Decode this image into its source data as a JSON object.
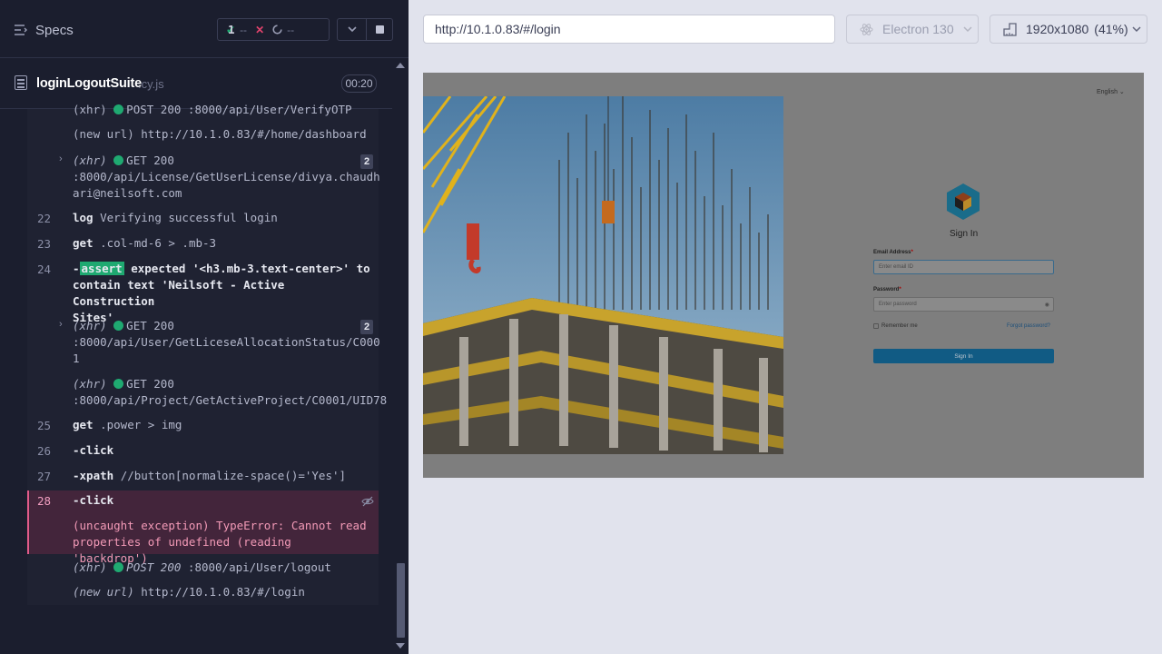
{
  "reporter": {
    "specs_label": "Specs",
    "stats": {
      "passed": "--",
      "failed": "1",
      "pending": "--"
    },
    "file": {
      "name": "loginLogoutSuite",
      "ext": ".cy.js",
      "duration": "00:20"
    }
  },
  "log": {
    "r0": {
      "kind": "(xhr)",
      "method": "POST 200",
      "url": ":8000/api/User/VerifyOTP"
    },
    "r1": {
      "kind": "(new url)",
      "url": "http://10.1.0.83/#/home/dashboard"
    },
    "r2": {
      "kind": "(xhr)",
      "method": "GET 200",
      "url1": ":8000/api/License/GetUserLicense/divya.chaudh",
      "url2": "ari@neilsoft.com",
      "count": "2"
    },
    "r3": {
      "num": "22",
      "name": "log",
      "msg": "Verifying successful login"
    },
    "r4": {
      "num": "23",
      "name": "get",
      "msg": ".col-md-6 > .mb-3"
    },
    "r5": {
      "num": "24",
      "prefix": "-",
      "name": "assert",
      "t1": "expected",
      "v1": "'<h3.mb-3.text-center>'",
      "t2": "to",
      "t3": "contain text",
      "v2a": "'Neilsoft - Active Construction",
      "v2b": "Sites'"
    },
    "r6": {
      "kind": "(xhr)",
      "method": "GET 200",
      "url1": ":8000/api/User/GetLiceseAllocationStatus/C000",
      "url2": "1",
      "count": "2"
    },
    "r7": {
      "kind": "(xhr)",
      "method": "GET 200",
      "url": ":8000/api/Project/GetActiveProject/C0001/UID78"
    },
    "r8": {
      "num": "25",
      "name": "get",
      "msg": ".power > img"
    },
    "r9": {
      "num": "26",
      "name": "-click"
    },
    "r10": {
      "num": "27",
      "name": "-xpath",
      "msg": "//button[normalize-space()='Yes']"
    },
    "r11": {
      "num": "28",
      "name": "-click",
      "err1": "(uncaught exception)",
      "err2": "TypeError: Cannot read",
      "err3": "properties of undefined (reading 'backdrop')"
    },
    "r12": {
      "kind": "(xhr)",
      "method": "POST 200",
      "url": ":8000/api/User/logout"
    },
    "r13": {
      "kind": "(new url)",
      "url": "http://10.1.0.83/#/login"
    }
  },
  "runner": {
    "url": "http://10.1.0.83/#/login",
    "browser": "Electron 130",
    "viewport": "1920x1080",
    "scale": "(41%)"
  },
  "aut": {
    "language": "English",
    "title": "Sign In",
    "email_label": "Email Address",
    "email_placeholder": "Enter email ID",
    "password_label": "Password",
    "password_placeholder": "Enter password",
    "remember": "Remember me",
    "forgot": "Forgot password?",
    "button": "Sign In",
    "required_mark": "*"
  },
  "colors": {
    "passed": "#1fa971",
    "failed": "#e1436c",
    "accent": "#115b84"
  }
}
